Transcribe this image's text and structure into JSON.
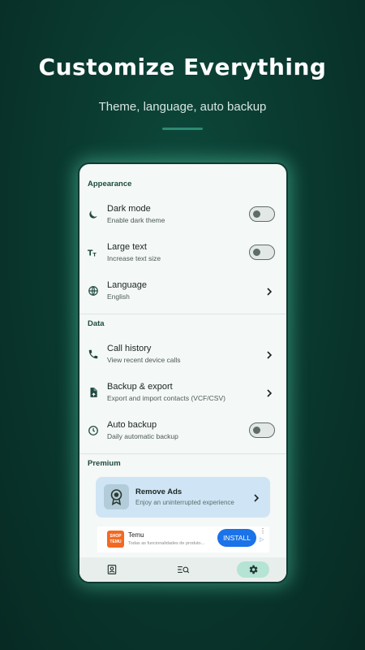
{
  "headline": "Customize Everything",
  "subheadline": "Theme, language, auto backup",
  "colors": {
    "background": "#0a3a30",
    "accent": "#2d8a72",
    "nav_active": "#b5e3d4",
    "premium_card": "#cfe5f5"
  },
  "settings": {
    "appearance": {
      "title": "Appearance",
      "dark_mode": {
        "title": "Dark mode",
        "subtitle": "Enable dark theme",
        "icon": "moon-icon",
        "enabled": false
      },
      "large_text": {
        "title": "Large text",
        "subtitle": "Increase text size",
        "icon": "text-size-icon",
        "enabled": false
      },
      "language": {
        "title": "Language",
        "subtitle": "English",
        "icon": "globe-icon"
      }
    },
    "data": {
      "title": "Data",
      "call_history": {
        "title": "Call history",
        "subtitle": "View recent device calls",
        "icon": "phone-icon"
      },
      "backup_export": {
        "title": "Backup & export",
        "subtitle": "Export and import contacts (VCF/CSV)",
        "icon": "file-upload-icon"
      },
      "auto_backup": {
        "title": "Auto backup",
        "subtitle": "Daily automatic backup",
        "icon": "clock-icon",
        "enabled": false
      }
    },
    "premium": {
      "title": "Premium",
      "remove_ads": {
        "title": "Remove Ads",
        "subtitle": "Enjoy an uninterrupted experience",
        "icon": "award-icon"
      }
    }
  },
  "ad": {
    "logo_line1": "SHOP",
    "logo_line2": "TEMU",
    "name": "Temu",
    "description": "Todas as funcionalidades de produto...",
    "install_label": "INSTALL"
  },
  "navbar": {
    "items": [
      {
        "icon": "contacts-icon",
        "active": false
      },
      {
        "icon": "search-list-icon",
        "active": false
      },
      {
        "icon": "settings-gear-icon",
        "active": true
      }
    ]
  }
}
